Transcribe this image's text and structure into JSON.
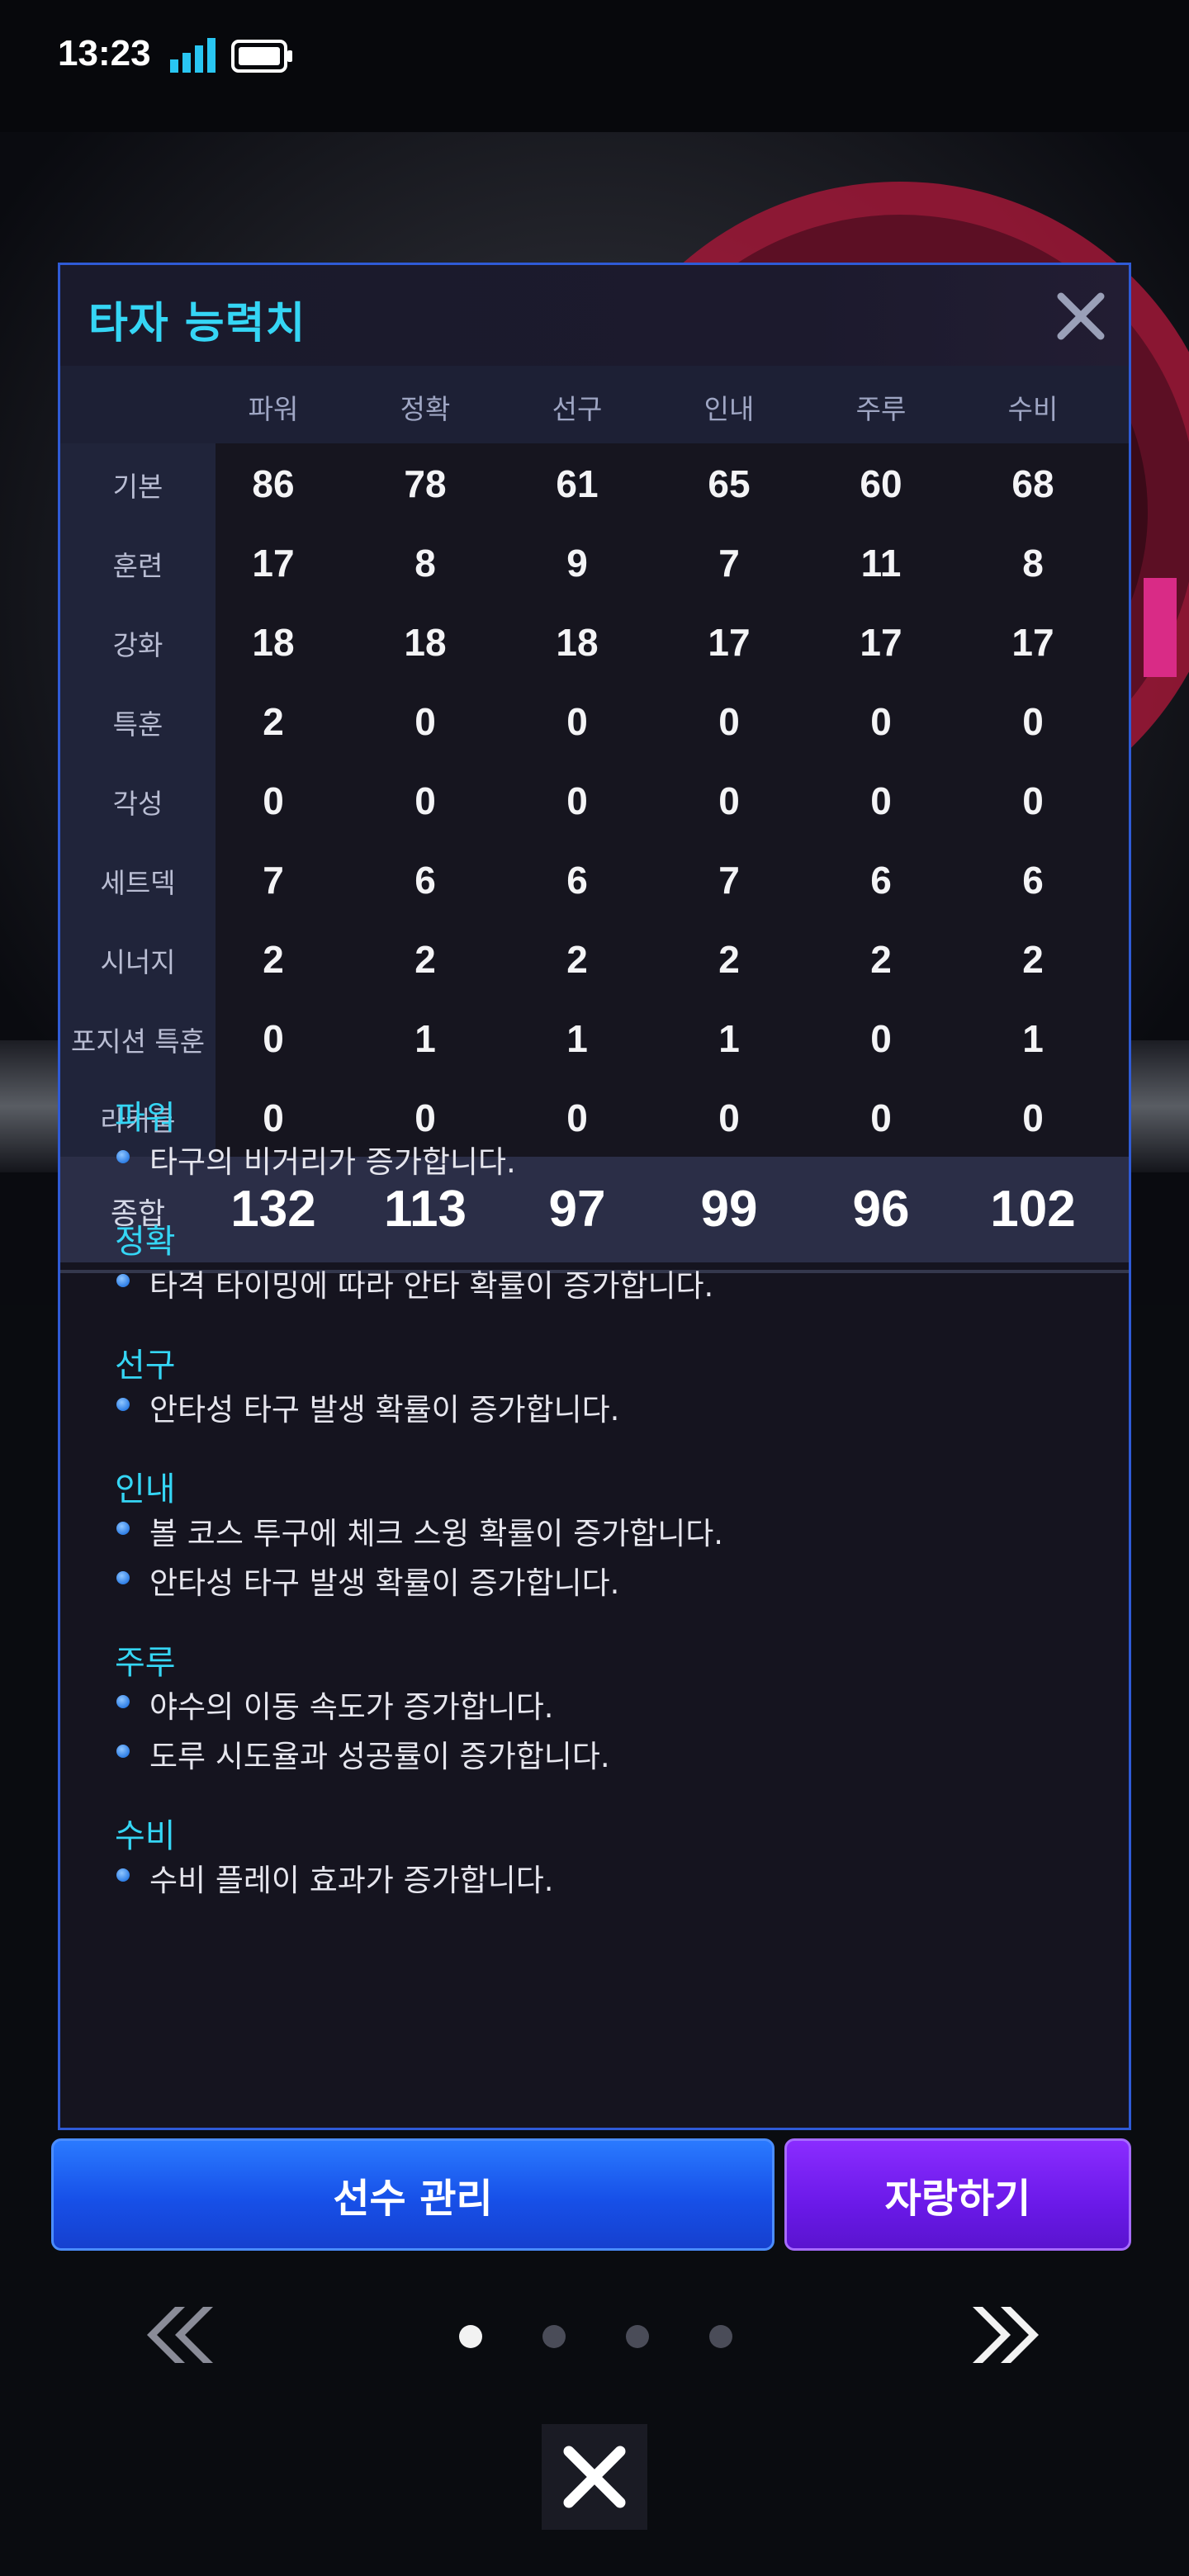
{
  "status_bar": {
    "time": "13:23"
  },
  "panel": {
    "title": "타자 능력치",
    "columns": [
      "파워",
      "정확",
      "선구",
      "인내",
      "주루",
      "수비"
    ],
    "rows": [
      {
        "label": "기본",
        "values": [
          86,
          78,
          61,
          65,
          60,
          68
        ]
      },
      {
        "label": "훈련",
        "values": [
          17,
          8,
          9,
          7,
          11,
          8
        ]
      },
      {
        "label": "강화",
        "values": [
          18,
          18,
          18,
          17,
          17,
          17
        ]
      },
      {
        "label": "특훈",
        "values": [
          2,
          0,
          0,
          0,
          0,
          0
        ]
      },
      {
        "label": "각성",
        "values": [
          0,
          0,
          0,
          0,
          0,
          0
        ]
      },
      {
        "label": "세트덱",
        "values": [
          7,
          6,
          6,
          7,
          6,
          6
        ]
      },
      {
        "label": "시너지",
        "values": [
          2,
          2,
          2,
          2,
          2,
          2
        ]
      },
      {
        "label": "포지션 특훈",
        "values": [
          0,
          1,
          1,
          1,
          0,
          1
        ]
      },
      {
        "label": "라커룸",
        "values": [
          0,
          0,
          0,
          0,
          0,
          0
        ]
      }
    ],
    "total": {
      "label": "종합",
      "values": [
        132,
        113,
        97,
        99,
        96,
        102
      ]
    },
    "descriptions": [
      {
        "title": "파워",
        "lines": [
          "타구의 비거리가 증가합니다."
        ]
      },
      {
        "title": "정확",
        "lines": [
          "타격 타이밍에 따라 안타 확률이 증가합니다."
        ]
      },
      {
        "title": "선구",
        "lines": [
          "안타성 타구 발생 확률이 증가합니다."
        ]
      },
      {
        "title": "인내",
        "lines": [
          "볼 코스 투구에 체크 스윙 확률이 증가합니다.",
          "안타성 타구 발생 확률이 증가합니다."
        ]
      },
      {
        "title": "주루",
        "lines": [
          "야수의 이동 속도가 증가합니다.",
          "도루 시도율과 성공률이 증가합니다."
        ]
      },
      {
        "title": "수비",
        "lines": [
          "수비 플레이 효과가 증가합니다."
        ]
      }
    ]
  },
  "actions": {
    "manage_label": "선수 관리",
    "share_label": "자랑하기"
  },
  "pager": {
    "total_pages": 4,
    "current_page": 1
  },
  "icons": {
    "close": "close-icon",
    "prev": "double-chevron-left-icon",
    "next": "double-chevron-right-icon",
    "signal": "signal-icon",
    "battery": "battery-icon"
  },
  "colors": {
    "accent": "#35d6f5",
    "panel_border": "#2f5bd6",
    "manage_button": "#1750e8",
    "share_button": "#6a19e8"
  }
}
